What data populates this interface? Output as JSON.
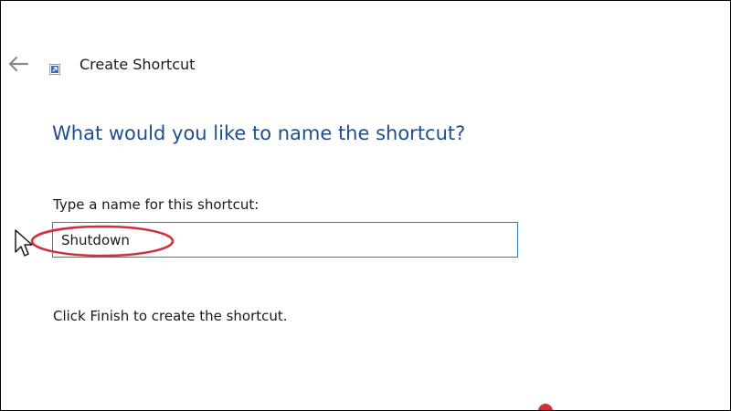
{
  "window": {
    "title": "Create Shortcut"
  },
  "icons": {
    "back": "arrow-left-icon",
    "shortcut": "shortcut-icon",
    "cursor": "mouse-pointer-icon"
  },
  "main": {
    "heading": "What would you like to name the shortcut?",
    "name_label": "Type a name for this shortcut:",
    "name_value": "Shutdown",
    "hint": "Click Finish to create the shortcut."
  },
  "colors": {
    "heading": "#1f4e8c",
    "input_border": "#2e7fc1",
    "annotation": "#d0303a"
  }
}
